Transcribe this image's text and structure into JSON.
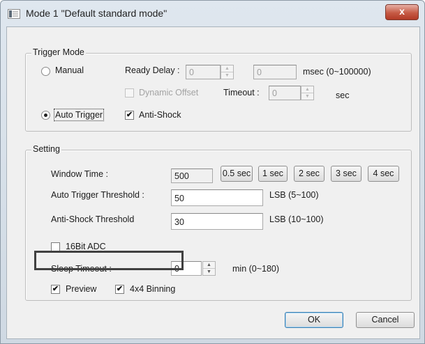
{
  "window": {
    "title": "Mode 1 \"Default standard mode\"",
    "close_label": "x"
  },
  "trigger_mode": {
    "legend": "Trigger Mode",
    "manual_label": "Manual",
    "auto_trigger_label": "Auto Trigger",
    "selected": "Auto Trigger",
    "ready_delay_label": "Ready Delay :",
    "ready_delay_value": "0",
    "ready_delay_msec_value": "0",
    "msec_range_label": "msec (0~100000)",
    "dynamic_offset_label": "Dynamic Offset",
    "dynamic_offset_checked": false,
    "timeout_label": "Timeout :",
    "timeout_value": "0",
    "sec_label": "sec",
    "anti_shock_label": "Anti-Shock",
    "anti_shock_checked": true
  },
  "setting": {
    "legend": "Setting",
    "window_time_label": "Window Time :",
    "window_time_value": "500",
    "presets": [
      "0.5 sec",
      "1 sec",
      "2 sec",
      "3 sec",
      "4 sec"
    ],
    "auto_trigger_threshold_label": "Auto Trigger Threshold :",
    "auto_trigger_threshold_value": "50",
    "auto_trigger_threshold_unit": "LSB (5~100)",
    "anti_shock_threshold_label": "Anti-Shock Threshold",
    "anti_shock_threshold_value": "30",
    "anti_shock_threshold_unit": "LSB (10~100)",
    "adc16_label": "16Bit ADC",
    "adc16_checked": false,
    "sleep_timeout_label": "Sleep Timeout :",
    "sleep_timeout_value": "0",
    "sleep_timeout_unit": "min (0~180)",
    "preview_label": "Preview",
    "preview_checked": true,
    "binning_label": "4x4 Binning",
    "binning_checked": true
  },
  "buttons": {
    "ok": "OK",
    "cancel": "Cancel"
  },
  "icons": {
    "check": "✔",
    "spin_up": "▲",
    "spin_down": "▼"
  }
}
